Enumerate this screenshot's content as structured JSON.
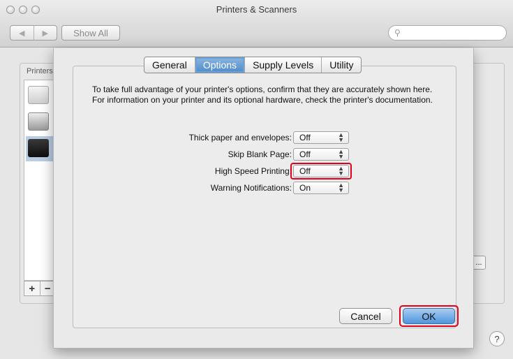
{
  "window": {
    "title": "Printers & Scanners",
    "show_all_label": "Show All",
    "back_glyph": "◀",
    "forward_glyph": "▶",
    "search_icon": "search-icon",
    "search_glyph": "⚲",
    "help_glyph": "?"
  },
  "background": {
    "list_label": "Printers",
    "plus": "+",
    "minus": "−",
    "ellipsis": "..."
  },
  "sheet": {
    "tabs": [
      "General",
      "Options",
      "Supply Levels",
      "Utility"
    ],
    "active_tab": "Options",
    "description": "To take full advantage of your printer's options, confirm that they are accurately shown here. For information on your printer and its optional hardware, check the printer's documentation.",
    "options": [
      {
        "label": "Thick paper and envelopes:",
        "value": "Off"
      },
      {
        "label": "Skip Blank Page:",
        "value": "Off"
      },
      {
        "label": "High Speed Printing:",
        "value": "Off",
        "highlighted": true
      },
      {
        "label": "Warning Notifications:",
        "value": "On"
      }
    ],
    "cancel_label": "Cancel",
    "ok_label": "OK"
  },
  "colors": {
    "highlight": "#e2001a",
    "accent": "#4f95dd"
  }
}
